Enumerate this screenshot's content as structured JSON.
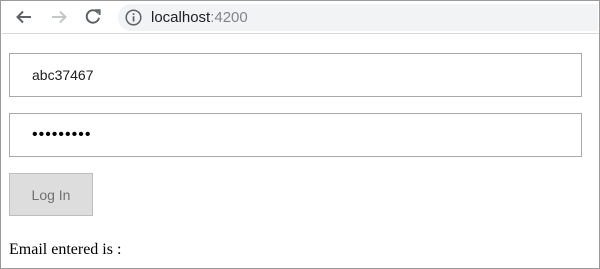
{
  "browser": {
    "url_host": "localhost",
    "url_port": ":4200",
    "icons": {
      "back": "arrow-left-icon",
      "forward": "arrow-right-icon",
      "reload": "reload-icon",
      "info": "info-icon"
    }
  },
  "form": {
    "email_value": "abc37467",
    "password_value": "•••••••••",
    "login_label": "Log In",
    "login_disabled": true
  },
  "output": {
    "email_entered_label": "Email entered is :"
  },
  "colors": {
    "button_bg": "#dddddd",
    "button_text": "#707070",
    "omnibox_bg": "#f1f3f4"
  }
}
